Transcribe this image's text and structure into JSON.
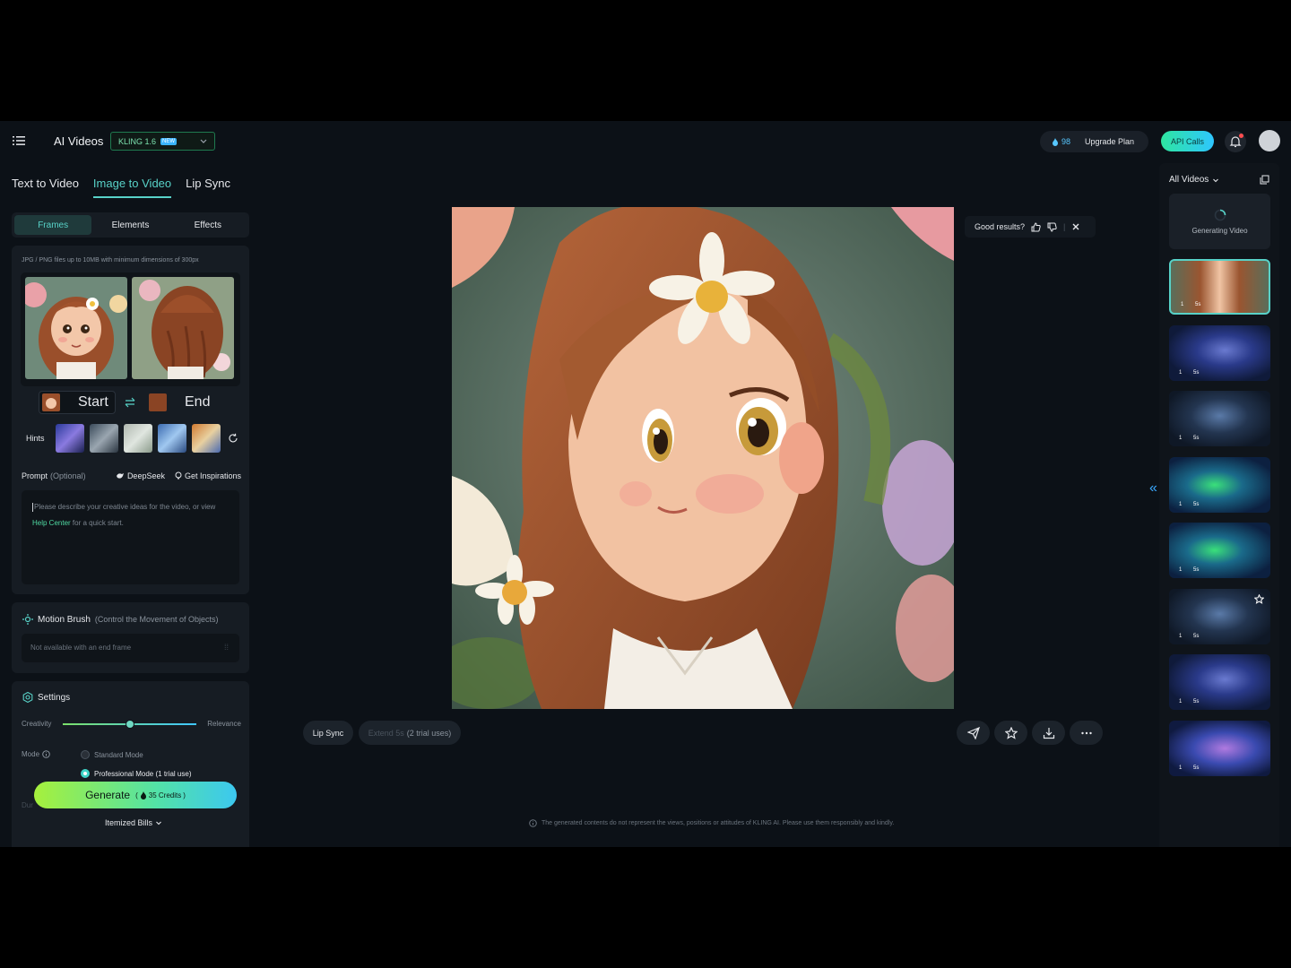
{
  "header": {
    "app_title": "AI Videos",
    "model": "KLING 1.6",
    "model_badge": "NEW",
    "credits": "98",
    "upgrade_label": "Upgrade Plan",
    "api_label": "API Calls"
  },
  "main_tabs": [
    "Text to Video",
    "Image to Video",
    "Lip Sync"
  ],
  "sub_tabs": [
    "Frames",
    "Elements",
    "Effects"
  ],
  "frames": {
    "upload_hint": "JPG / PNG files up to 10MB with minimum dimensions of 300px",
    "start_label": "Start",
    "end_label": "End",
    "hints_label": "Hints"
  },
  "prompt": {
    "label": "Prompt",
    "optional": "(Optional)",
    "deepseek": "DeepSeek",
    "inspirations": "Get Inspirations",
    "placeholder_pre": "Please describe your creative ideas for the video, or view ",
    "placeholder_link": "Help Center",
    "placeholder_post": " for a quick start."
  },
  "motion_brush": {
    "title": "Motion Brush",
    "subtitle": "(Control the Movement of Objects)",
    "status": "Not available with an end frame"
  },
  "settings": {
    "title": "Settings",
    "creativity": "Creativity",
    "relevance": "Relevance",
    "slider_value": 0.5,
    "mode_label": "Mode",
    "standard_mode": "Standard Mode",
    "pro_mode": "Professional Mode (1 trial use)",
    "duration_peek": "Dur"
  },
  "generate": {
    "label": "Generate",
    "credits_text": "35 Credits",
    "open_paren": "(",
    "close_paren": ")",
    "bills": "Itemized Bills"
  },
  "preview": {
    "feedback": "Good results?",
    "lip_sync": "Lip Sync",
    "extend": "Extend 5s",
    "extend_trial": "(2 trial uses)",
    "disclaimer": "The generated contents do not represent the views, positions or attitudes of KLING AI. Please use them responsibly and kindly."
  },
  "history": {
    "filter": "All Videos",
    "generating": "Generating Video",
    "items": [
      {
        "count": "1",
        "duration": "5s",
        "kind": "girl"
      },
      {
        "count": "1",
        "duration": "5s",
        "kind": "blue"
      },
      {
        "count": "1",
        "duration": "5s",
        "kind": "dark"
      },
      {
        "count": "1",
        "duration": "5s",
        "kind": "green"
      },
      {
        "count": "1",
        "duration": "5s",
        "kind": "green"
      },
      {
        "count": "1",
        "duration": "5s",
        "kind": "dark"
      },
      {
        "count": "1",
        "duration": "5s",
        "kind": "blue"
      },
      {
        "count": "1",
        "duration": "5s",
        "kind": "purple"
      }
    ]
  },
  "colors": {
    "accent": "#58d2c8",
    "background": "#0c1117",
    "panel": "#161c23"
  }
}
